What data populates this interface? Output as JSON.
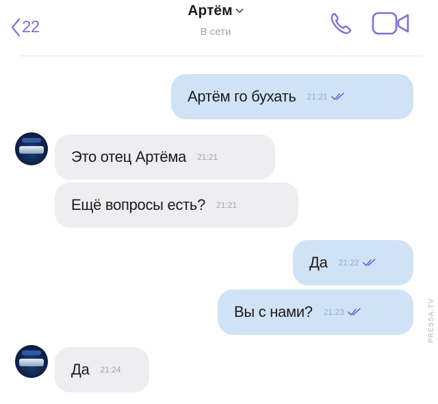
{
  "header": {
    "back_count": "22",
    "contact_name": "Артём",
    "status": "В сети"
  },
  "messages": [
    {
      "direction": "outgoing",
      "text": "Артём го бухать",
      "time": "21:21",
      "read": true
    },
    {
      "direction": "incoming",
      "text": "Это отец Артёма",
      "time": "21:21"
    },
    {
      "direction": "incoming",
      "text": "Ещё вопросы есть?",
      "time": "21:21"
    },
    {
      "direction": "outgoing",
      "text": "Да",
      "time": "21:22",
      "read": true
    },
    {
      "direction": "outgoing",
      "text": "Вы с нами?",
      "time": "21:23",
      "read": true
    },
    {
      "direction": "incoming",
      "text": "Да",
      "time": "21:24"
    }
  ],
  "watermark": "PRESSA.TV",
  "icons": {
    "back": "chevron-left-icon",
    "dropdown": "chevron-down-icon",
    "call": "phone-icon",
    "video": "video-camera-icon",
    "read_status": "double-check-icon"
  },
  "colors": {
    "accent": "#7d6fd6",
    "outgoing_bubble": "#d0e3f6",
    "incoming_bubble": "#eeeef1",
    "read_ticks": "#6f5fd0"
  }
}
